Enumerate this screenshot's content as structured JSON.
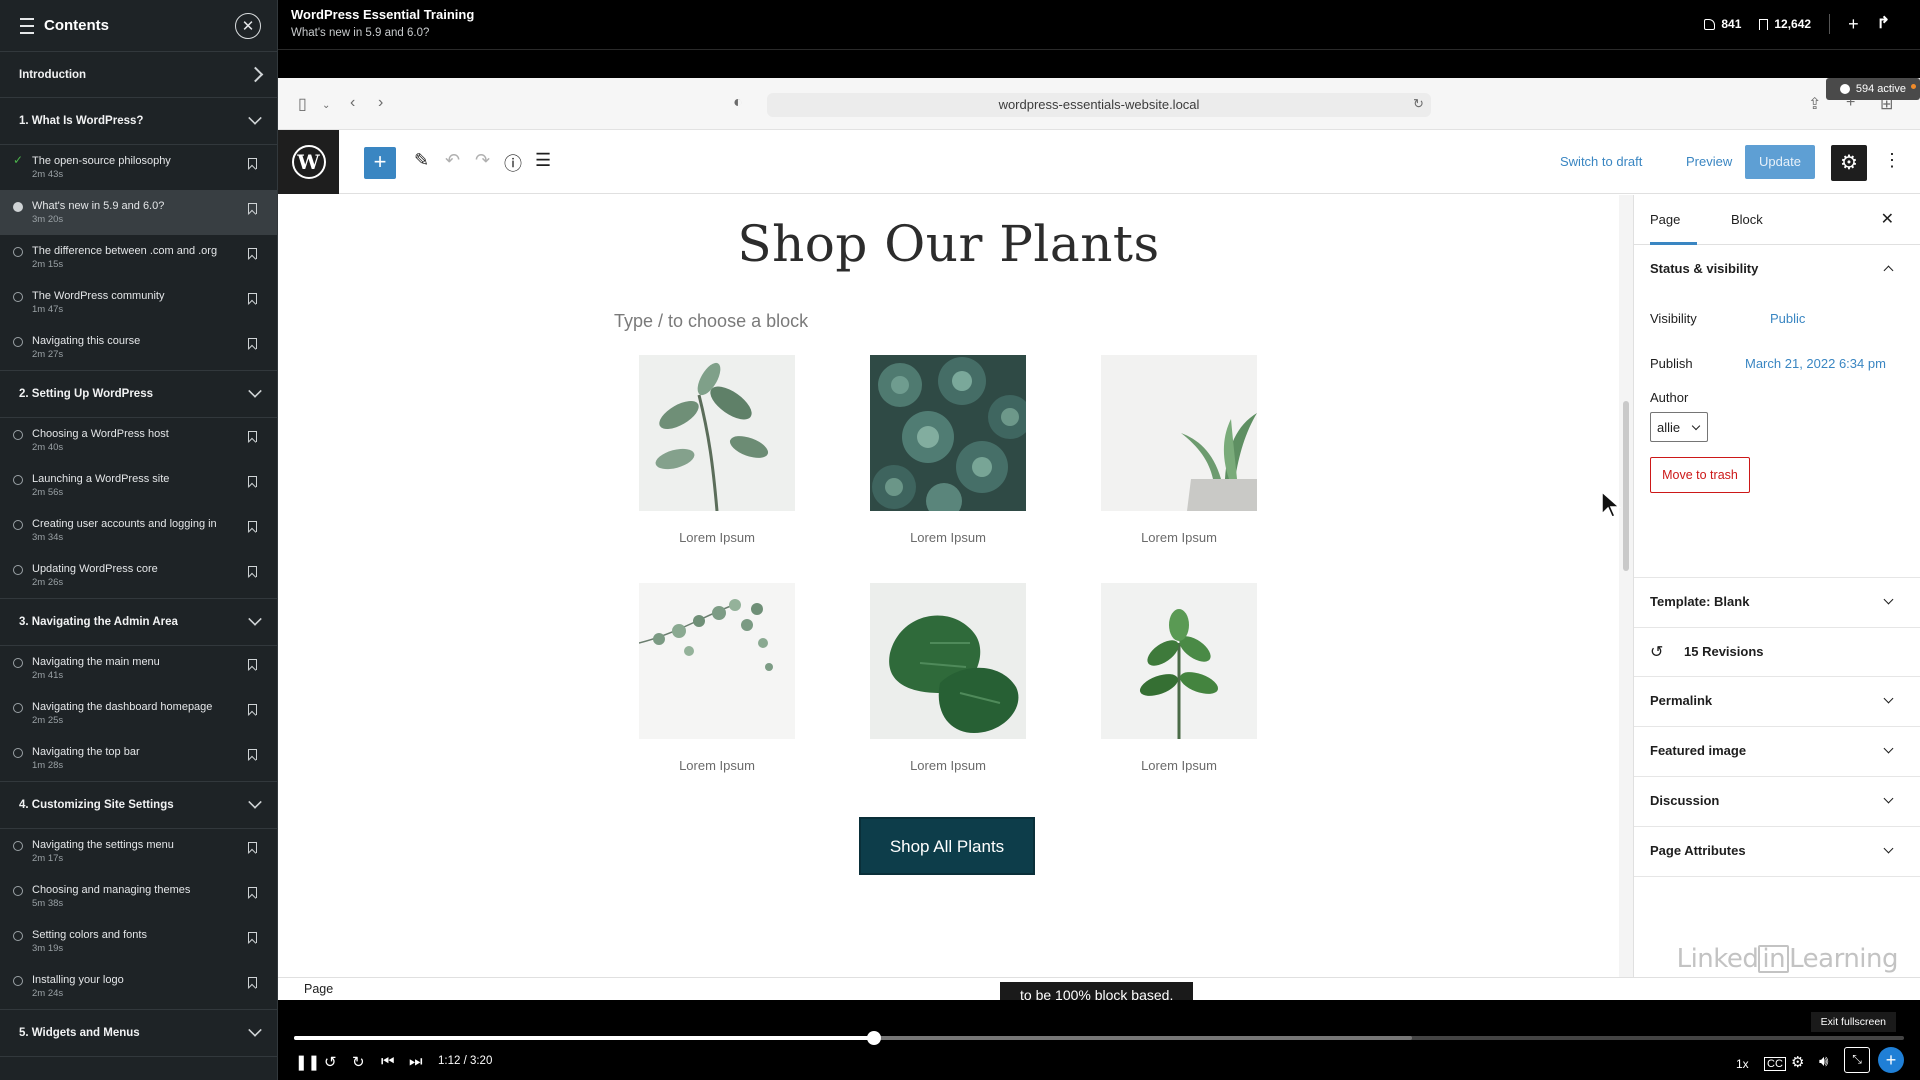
{
  "sidebar": {
    "title": "Contents",
    "intro_label": "Introduction",
    "sections": [
      {
        "label": "1. What Is WordPress?",
        "lessons": [
          {
            "title": "The open-source philosophy",
            "duration": "2m 43s",
            "status": "done"
          },
          {
            "title": "What's new in 5.9 and 6.0?",
            "duration": "3m 20s",
            "status": "current"
          },
          {
            "title": "The difference between .com and .org",
            "duration": "2m 15s",
            "status": "todo"
          },
          {
            "title": "The WordPress community",
            "duration": "1m 47s",
            "status": "todo"
          },
          {
            "title": "Navigating this course",
            "duration": "2m 27s",
            "status": "todo"
          }
        ]
      },
      {
        "label": "2. Setting Up WordPress",
        "lessons": [
          {
            "title": "Choosing a WordPress host",
            "duration": "2m 40s",
            "status": "todo"
          },
          {
            "title": "Launching a WordPress site",
            "duration": "2m 56s",
            "status": "todo"
          },
          {
            "title": "Creating user accounts and logging in",
            "duration": "3m 34s",
            "status": "todo"
          },
          {
            "title": "Updating WordPress core",
            "duration": "2m 26s",
            "status": "todo"
          }
        ]
      },
      {
        "label": "3. Navigating the Admin Area",
        "lessons": [
          {
            "title": "Navigating the main menu",
            "duration": "2m 41s",
            "status": "todo"
          },
          {
            "title": "Navigating the dashboard homepage",
            "duration": "2m 25s",
            "status": "todo"
          },
          {
            "title": "Navigating the top bar",
            "duration": "1m 28s",
            "status": "todo"
          }
        ]
      },
      {
        "label": "4. Customizing Site Settings",
        "lessons": [
          {
            "title": "Navigating the settings menu",
            "duration": "2m 17s",
            "status": "todo"
          },
          {
            "title": "Choosing and managing themes",
            "duration": "5m 38s",
            "status": "todo"
          },
          {
            "title": "Setting colors and fonts",
            "duration": "3m 19s",
            "status": "todo"
          },
          {
            "title": "Installing your logo",
            "duration": "2m 24s",
            "status": "todo"
          }
        ]
      },
      {
        "label": "5. Widgets and Menus",
        "lessons": []
      }
    ]
  },
  "topbar": {
    "course_title": "WordPress Essential Training",
    "video_title": "What's new in 5.9 and 6.0?",
    "likes": "841",
    "saves": "12,642"
  },
  "browser": {
    "url": "wordpress-essentials-website.local",
    "active_badge": "594 active"
  },
  "editor": {
    "switch_draft": "Switch to draft",
    "preview": "Preview",
    "update": "Update",
    "page_heading": "Shop Our Plants",
    "block_hint": "Type / to choose a block",
    "grid_caption": "Lorem Ipsum",
    "shop_button": "Shop All Plants",
    "status_crumb": "Page"
  },
  "inspector": {
    "tab_page": "Page",
    "tab_block": "Block",
    "status_visibility": "Status & visibility",
    "visibility_label": "Visibility",
    "visibility_value": "Public",
    "publish_label": "Publish",
    "publish_value": "March 21, 2022 6:34 pm",
    "author_label": "Author",
    "author_value": "allie",
    "move_to_trash": "Move to trash",
    "template": "Template: Blank",
    "revisions": "15 Revisions",
    "permalink": "Permalink",
    "featured_image": "Featured image",
    "discussion": "Discussion",
    "page_attributes": "Page Attributes"
  },
  "watermark": {
    "left": "Linked",
    "in": "in",
    "right": "Learning"
  },
  "caption": "to be 100% block based.",
  "player": {
    "time": "1:12 / 3:20",
    "progress": 0.36,
    "speed": "1x",
    "exit_fullscreen": "Exit fullscreen"
  }
}
